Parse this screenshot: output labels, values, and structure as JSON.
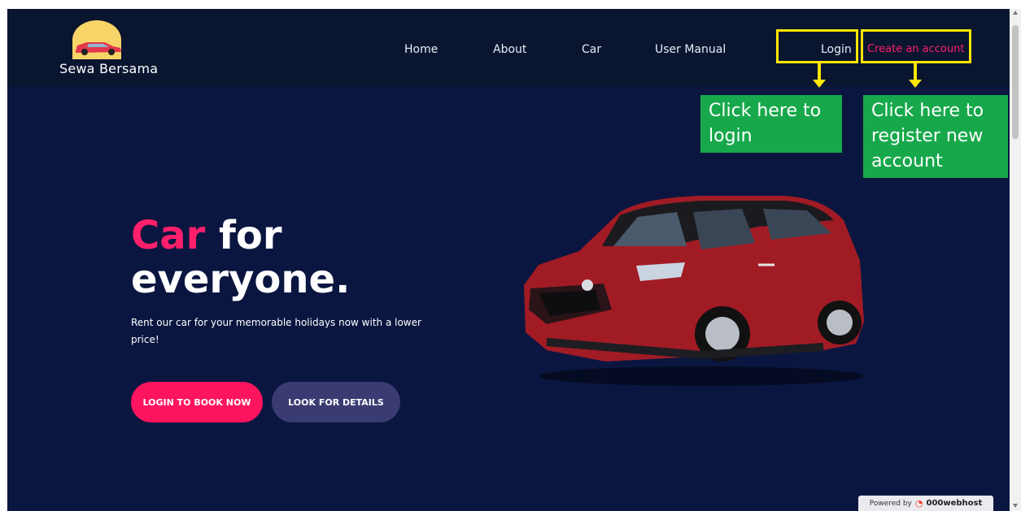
{
  "brand": {
    "name": "Sewa Bersama"
  },
  "nav": {
    "home": "Home",
    "about": "About",
    "car": "Car",
    "user_manual": "User Manual",
    "login": "Login",
    "create_account": "Create an account"
  },
  "annotations": {
    "login_callout": "Click here to login",
    "register_callout": "Click here to register new account"
  },
  "hero": {
    "title_accent": "Car",
    "title_rest": " for",
    "title_line2": "everyone.",
    "subtitle": "Rent our car for your memorable holidays now with a lower price!",
    "primary_button": "LOGIN TO BOOK NOW",
    "secondary_button": "LOOK FOR DETAILS"
  },
  "footer_badge": {
    "prefix": "Powered by",
    "host": "000webhost"
  },
  "colors": {
    "background": "#0b1640",
    "navbar": "#0a1530",
    "accent": "#ff1f6a",
    "secondary_button": "#3a3b72",
    "highlight": "#ffe600",
    "callout": "#17a84b"
  }
}
